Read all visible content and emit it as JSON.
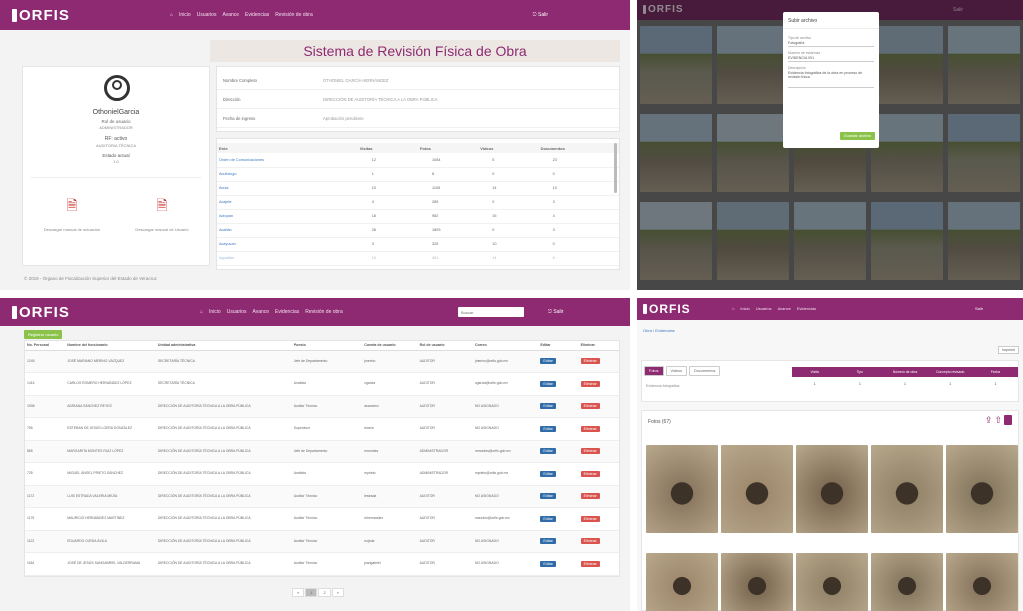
{
  "brand": {
    "logo": "ORFIS",
    "primary": "#8d2a72"
  },
  "nav": {
    "links": [
      "Inicio",
      "Usuarios",
      "Avance",
      "Evidencias",
      "Revisión de obra"
    ],
    "exit_label": "Salir"
  },
  "review": {
    "title": "Sistema de Revisión Física de Obra",
    "user": {
      "username": "OthonielGarcia",
      "rol_label": "Rol de usuario",
      "rol_value": "ADMINISTRADOR",
      "rfc_label": "RF: activo",
      "area": "AUDITORIA TÉCNICA",
      "estado_label": "Estado actual",
      "estado_value": "1.0"
    },
    "downloads": [
      "Descargar manual de actuación",
      "Descargar manual de Usuario"
    ],
    "info_rows": [
      {
        "label": "Nombre Completo",
        "value": "OTHONIEL GARCÍA HERNÁNDEZ"
      },
      {
        "label": "Dirección",
        "value": "DIRECCIÓN DE AUDITORÍA TÉCNICA A LA OBRA PÚBLICA"
      },
      {
        "label": "Fecha de ingreso",
        "value": "Aprobación pendiente"
      }
    ],
    "table_headers": [
      "Ente",
      "Visitas",
      "Fotos",
      "Videos",
      "Documentos"
    ],
    "table_rows": [
      [
        "Orden de Comunicaciones",
        "12",
        "1084",
        "5",
        "23"
      ],
      [
        "Acultzingo",
        "1",
        "8",
        "0",
        "0"
      ],
      [
        "Acula",
        "10",
        "1105",
        "14",
        "10"
      ],
      [
        "Acajete",
        "4",
        "285",
        "0",
        "3"
      ],
      [
        "Actopan",
        "18",
        "982",
        "15",
        "4"
      ],
      [
        "Acatlán",
        "28",
        "1893",
        "0",
        "3"
      ],
      [
        "Acayucan",
        "3",
        "325",
        "10",
        "0"
      ],
      [
        "Aguatlán",
        "10",
        "401",
        "14",
        "6"
      ]
    ],
    "footer": "© 2019 - Órgano de Fiscalización Superior del Estado de Veracruz"
  },
  "users_panel": {
    "search_placeholder": "Buscar",
    "add_button": "Registrar usuario",
    "headers": [
      "No. Personal",
      "Nombre del funcionario",
      "Unidad administrativa",
      "Puesto",
      "Cuenta de usuario",
      "Rol de usuario",
      "Correo",
      "Editar",
      "Eliminar"
    ],
    "rows": [
      [
        "1245",
        "JOSÉ MARIANO MERINO VÁZQUEZ",
        "SECRETARÍA TÉCNICA",
        "Jefe de Departamento",
        "jmerino",
        "AUDITOR",
        "jmerino@orfis.gob.mx"
      ],
      [
        "1416",
        "CARLOS ROMERO HERNÁNDEZ LÓPEZ",
        "SECRETARÍA TÉCNICA",
        "Analista",
        "cgarcia",
        "AUDITOR",
        "cgarcia@orfis.gob.mx"
      ],
      [
        "1908",
        "ADRIANA SÁNCHEZ REYES",
        "DIRECCIÓN DE AUDITORÍA TÉCNICA A LA OBRA PÚBLICA",
        "Auditor Técnico",
        "asanchez",
        "AUDITOR",
        "NO ASIGNADO"
      ],
      [
        "755",
        "ESTEBAN DE JESÚS LOERA GONZÁLEZ",
        "DIRECCIÓN DE AUDITORÍA TÉCNICA A LA OBRA PÚBLICA",
        "Supervisor",
        "eloera",
        "AUDITOR",
        "NO ASIGNADO"
      ],
      [
        "865",
        "MARGARITA MONTES RUIZ LÓPEZ",
        "DIRECCIÓN DE AUDITORÍA TÉCNICA A LA OBRA PÚBLICA",
        "Jefe de Departamento",
        "mmontes",
        "ADMINISTRADOR",
        "mmontes@orfis.gob.mx"
      ],
      [
        "725",
        "MIGUEL ÁNGEL PRIETO SÁNCHEZ",
        "DIRECCIÓN DE AUDITORÍA TÉCNICA A LA OBRA PÚBLICA",
        "Analista",
        "mprieto",
        "ADMINISTRADOR",
        "mprieto@orfis.gob.mx"
      ],
      [
        "1172",
        "LUIS ESTRADA VALERIA MEJÍA",
        "DIRECCIÓN DE AUDITORÍA TÉCNICA A LA OBRA PÚBLICA",
        "Auditor Técnico",
        "lestrada",
        "AUDITOR",
        "NO ASIGNADO"
      ],
      [
        "1175",
        "MAURICIO HERNÁNDEZ MARTÍNEZ",
        "DIRECCIÓN DE AUDITORÍA TÉCNICA A LA OBRA PÚBLICA",
        "Auditor Técnico",
        "mhernandez",
        "AUDITOR",
        "mauricio@orfis.gob.mx"
      ],
      [
        "1122",
        "EDUARDO OJEDA ÁVILA",
        "DIRECCIÓN DE AUDITORÍA TÉCNICA A LA OBRA PÚBLICA",
        "Auditor Técnico",
        "eojeda",
        "AUDITOR",
        "NO ASIGNADO"
      ],
      [
        "1184",
        "JOSÉ DE JESÚS SANGABRIEL VALDERRAMA",
        "DIRECCIÓN DE AUDITORÍA TÉCNICA A LA OBRA PÚBLICA",
        "Auditor Técnico",
        "jsangabriel",
        "AUDITOR",
        "NO ASIGNADO"
      ]
    ],
    "edit_label": "Editar",
    "delete_label": "Eliminar",
    "pages": [
      "«",
      "1",
      "2",
      "»"
    ]
  },
  "gallery_panel": {
    "modal_title": "Subir archivo",
    "modal_fields": [
      "Tipo de archivo",
      "Número de evidencia",
      "Descripción"
    ],
    "modal_values": [
      "Fotografía",
      "EVIDENCIA 001",
      "Evidencia fotográfica de la obra en proceso de revisión física"
    ],
    "modal_button": "Guardar archivo"
  },
  "visit_panel": {
    "breadcrumb": "Obra / Evidencias",
    "tabs": [
      "Fotos",
      "Videos",
      "Documentos"
    ],
    "table_headers": [
      "Visita",
      "Tipo",
      "Número de obra",
      "Concepto revisado",
      "Fecha"
    ],
    "visit_row": [
      "1",
      "1",
      "1",
      "1",
      "1"
    ],
    "left_caption": "Evidencia fotográfica",
    "section_label": "Fotos (67)",
    "print_label": "Imprimir"
  }
}
